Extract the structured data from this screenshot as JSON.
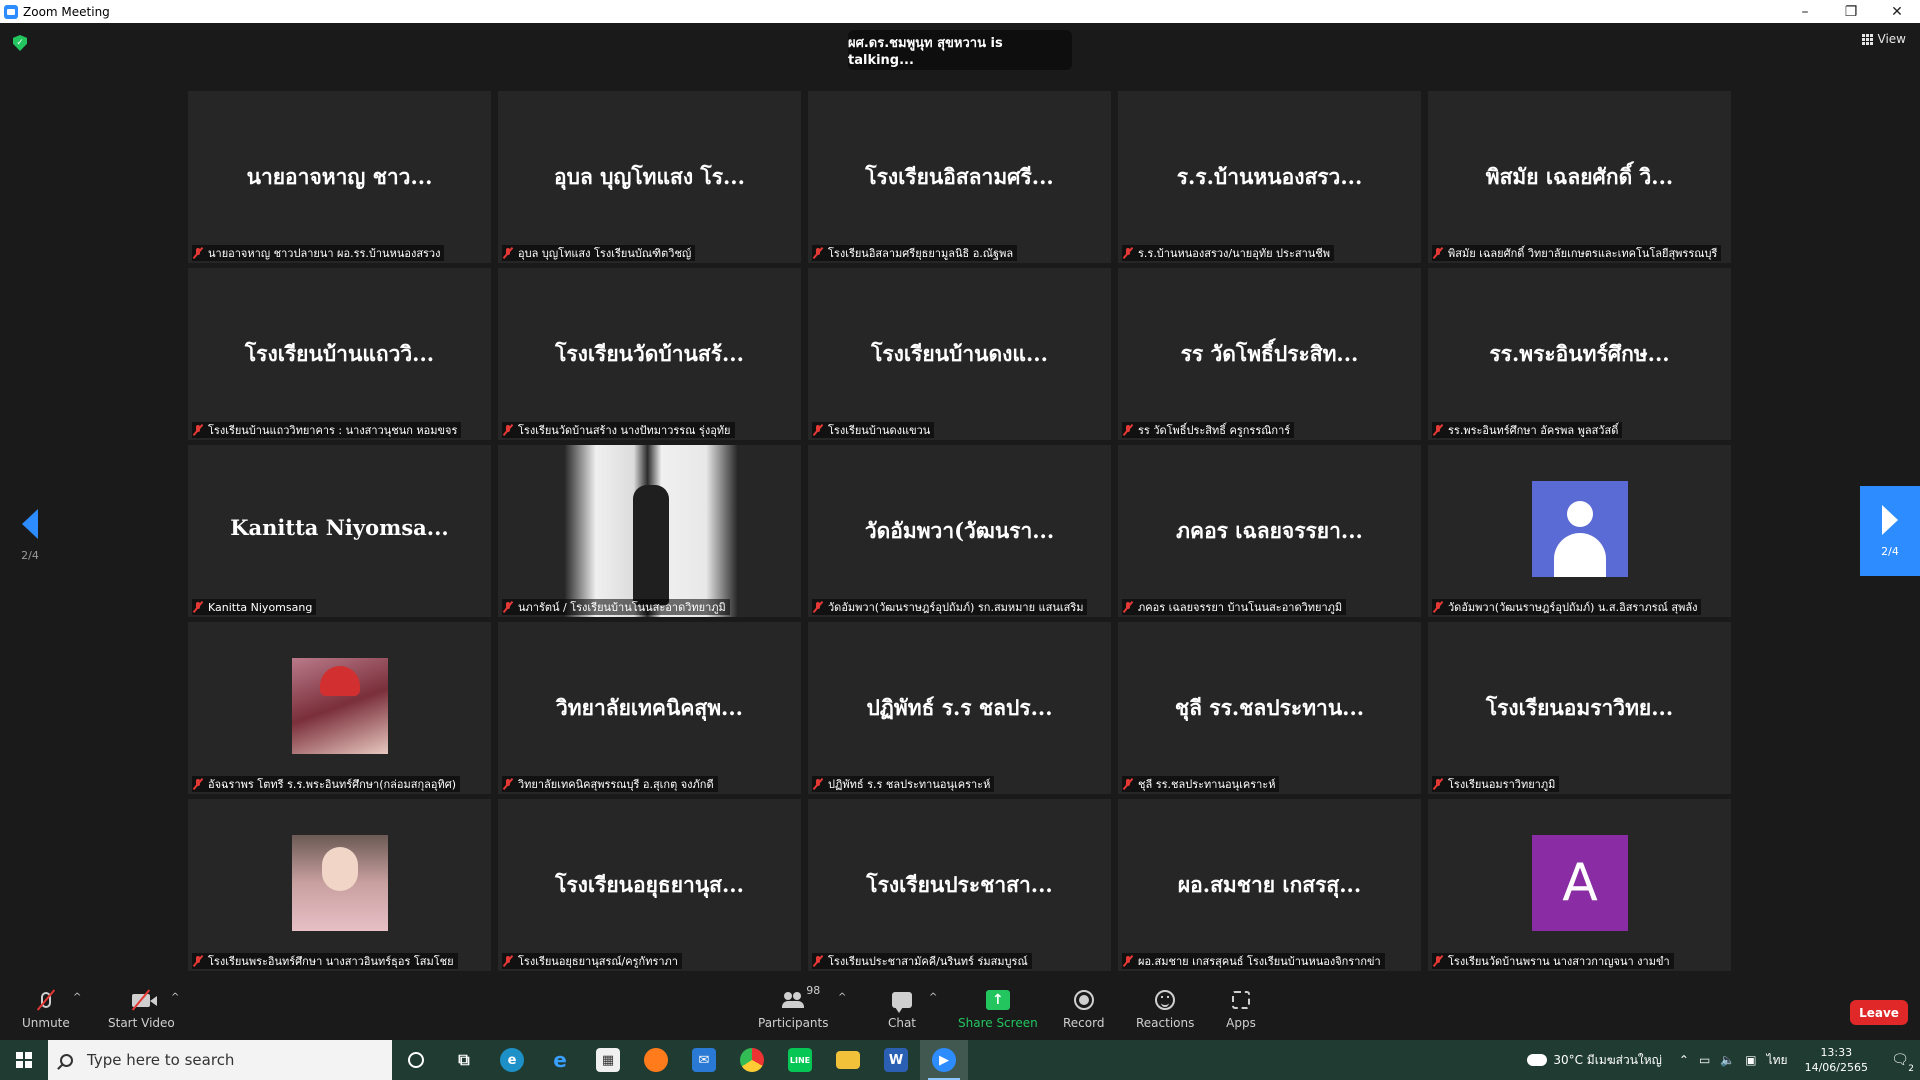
{
  "window": {
    "title": "Zoom Meeting",
    "minimize": "–",
    "restore": "❐",
    "close": "✕"
  },
  "meeting": {
    "talking_text": "ผศ.ดร.ชมพูนุท สุขหวาน is talking...",
    "view_label": "View",
    "page_indicator_left": "2/4",
    "page_indicator_right": "2/4"
  },
  "tiles": [
    {
      "display": "นายอาจหาญ ชาว...",
      "label": "นายอาจหาญ ชาวปลายนา ผอ.รร.บ้านหนองสรวง",
      "kind": "text"
    },
    {
      "display": "อุบล บุญโทแสง โร...",
      "label": "อุบล บุญโทแสง โรงเรียนบัณฑิตวิชญ์",
      "kind": "text"
    },
    {
      "display": "โรงเรียนอิสลามศรี...",
      "label": "โรงเรียนอิสลามศรียุธยามูลนิธิ อ.ณัฐพล",
      "kind": "text"
    },
    {
      "display": "ร.ร.บ้านหนองสรว...",
      "label": "ร.ร.บ้านหนองสรวง/นายอุทัย  ประสานชีพ",
      "kind": "text"
    },
    {
      "display": "พิสมัย เฉลยศักดิ์ วิ...",
      "label": "พิสมัย เฉลยศักดิ์ วิทยาลัยเกษตรและเทคโนโลยีสุพรรณบุรี",
      "kind": "text"
    },
    {
      "display": "โรงเรียนบ้านแถววิ...",
      "label": "โรงเรียนบ้านแถววิทยาคาร : นางสาวนุชนก หอมขจร",
      "kind": "text"
    },
    {
      "display": "โรงเรียนวัดบ้านสร้...",
      "label": "โรงเรียนวัดบ้านสร้าง นางปัทมาวรรณ รุ่งอุทัย",
      "kind": "text"
    },
    {
      "display": "โรงเรียนบ้านดงแ...",
      "label": "โรงเรียนบ้านดงแขวน",
      "kind": "text"
    },
    {
      "display": "รร วัดโพธิ์ประสิท...",
      "label": "รร วัดโพธิ์ประสิทธิ์ ครูกรรณิการ์",
      "kind": "text"
    },
    {
      "display": "รร.พระอินทร์ศึกษ...",
      "label": "รร.พระอินทร์ศึกษา  อัครพล พูลสวัสดิ์",
      "kind": "text"
    },
    {
      "display": "Kanitta  Niyomsa...",
      "label": "Kanitta Niyomsang",
      "kind": "text"
    },
    {
      "display": "",
      "label": "นภารัตน์ / โรงเรียนบ้านโนนสะอาดวิทยาภูมิ",
      "kind": "photo-window"
    },
    {
      "display": "วัดอัมพวา(วัฒนรา...",
      "label": "วัดอัมพวา(วัฒนราษฎร์อุปถัมภ์) รก.สมหมาย แสนเสริม",
      "kind": "text"
    },
    {
      "display": "ภคอร เฉลยจรรยา...",
      "label": "ภคอร เฉลยจรรยา บ้านโนนสะอาดวิทยาภูมิ",
      "kind": "text"
    },
    {
      "display": "",
      "label": "วัดอัมพวา(วัฒนราษฎร์อุปถัมภ์) น.ส.อิสราภรณ์ สุพลัง",
      "kind": "generic"
    },
    {
      "display": "",
      "label": "อัจฉราพร โตทรี ร.ร.พระอินทร์ศึกษา(กล่อมสกุลอุทิศ)",
      "kind": "photo-f1"
    },
    {
      "display": "วิทยาลัยเทคนิคสุพ...",
      "label": "วิทยาลัยเทคนิคสุพรรณบุรี อ.สุเกตุ จงภักดี",
      "kind": "text"
    },
    {
      "display": "ปฏิพัทธ์ ร.ร ชลปร...",
      "label": "ปฏิพัทธ์ ร.ร ชลประทานอนุเคราะห์",
      "kind": "text"
    },
    {
      "display": "ชุลี รร.ชลประทาน...",
      "label": "ชุลี รร.ชลประทานอนุเคราะห์",
      "kind": "text"
    },
    {
      "display": "โรงเรียนอมราวิทย...",
      "label": "โรงเรียนอมราวิทยาภูมิ",
      "kind": "text"
    },
    {
      "display": "",
      "label": "โรงเรียนพระอินทร์ศึกษา นางสาวอินทร์ธุอร โสมโชย",
      "kind": "photo-f2"
    },
    {
      "display": "โรงเรียนอยุธยานุส...",
      "label": "โรงเรียนอยุธยานุสรณ์/ครูกัทราภา",
      "kind": "text"
    },
    {
      "display": "โรงเรียนประชาสา...",
      "label": "โรงเรียนประชาสามัคคี/นรินทร์ ร่มสมบูรณ์",
      "kind": "text"
    },
    {
      "display": "ผอ.สมชาย เกสรสุ...",
      "label": "ผอ.สมชาย เกสรสุคนธ์ โรงเรียนบ้านหนองจิกรากข่า",
      "kind": "text"
    },
    {
      "display": "A",
      "label": "โรงเรียนวัดบ้านพราน นางสาวกาญจนา งามขำ",
      "kind": "letter"
    }
  ],
  "toolbar": {
    "unmute": "Unmute",
    "start_video": "Start Video",
    "participants": "Participants",
    "participants_count": "98",
    "chat": "Chat",
    "share_screen": "Share Screen",
    "record": "Record",
    "reactions": "Reactions",
    "apps": "Apps",
    "leave": "Leave",
    "caret": "^"
  },
  "taskbar": {
    "search_placeholder": "Type here to search",
    "weather": "30°C  มีเมฆส่วนใหญ่",
    "language": "ไทย",
    "time": "13:33",
    "date": "14/06/2565",
    "notification_count": "2"
  },
  "colors": {
    "accent": "#2d8cff",
    "leave": "#e02828",
    "share": "#22c55e",
    "muted": "#e53935"
  }
}
